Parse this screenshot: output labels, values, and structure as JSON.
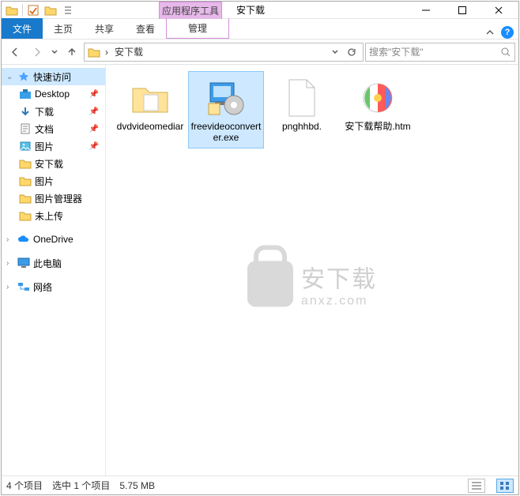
{
  "qat": {
    "context_title": "应用程序工具"
  },
  "window": {
    "title": "安下载"
  },
  "ribbon": {
    "tabs": {
      "file": "文件",
      "home": "主页",
      "share": "共享",
      "view": "查看",
      "context": "管理"
    }
  },
  "address": {
    "location": "安下载",
    "search_placeholder": "搜索\"安下载\""
  },
  "nav": {
    "quick_access": "快速访问",
    "items": [
      {
        "label": "Desktop",
        "pin": true
      },
      {
        "label": "下载",
        "pin": true
      },
      {
        "label": "文档",
        "pin": true
      },
      {
        "label": "图片",
        "pin": true
      },
      {
        "label": "安下载",
        "pin": false
      },
      {
        "label": "图片",
        "pin": false
      },
      {
        "label": "图片管理器",
        "pin": false
      },
      {
        "label": "未上传",
        "pin": false
      }
    ],
    "onedrive": "OneDrive",
    "this_pc": "此电脑",
    "network": "网络"
  },
  "files": [
    {
      "name": "dvdvideomediar",
      "type": "folder",
      "selected": false
    },
    {
      "name": "freevideoconverter.exe",
      "type": "exe",
      "selected": true
    },
    {
      "name": "pnghhbd.",
      "type": "file",
      "selected": false
    },
    {
      "name": "安下载帮助.htm",
      "type": "htm",
      "selected": false
    }
  ],
  "status": {
    "count": "4 个项目",
    "selection": "选中 1 个项目",
    "size": "5.75 MB"
  },
  "watermark": {
    "cn": "安下载",
    "en": "anxz.com"
  }
}
